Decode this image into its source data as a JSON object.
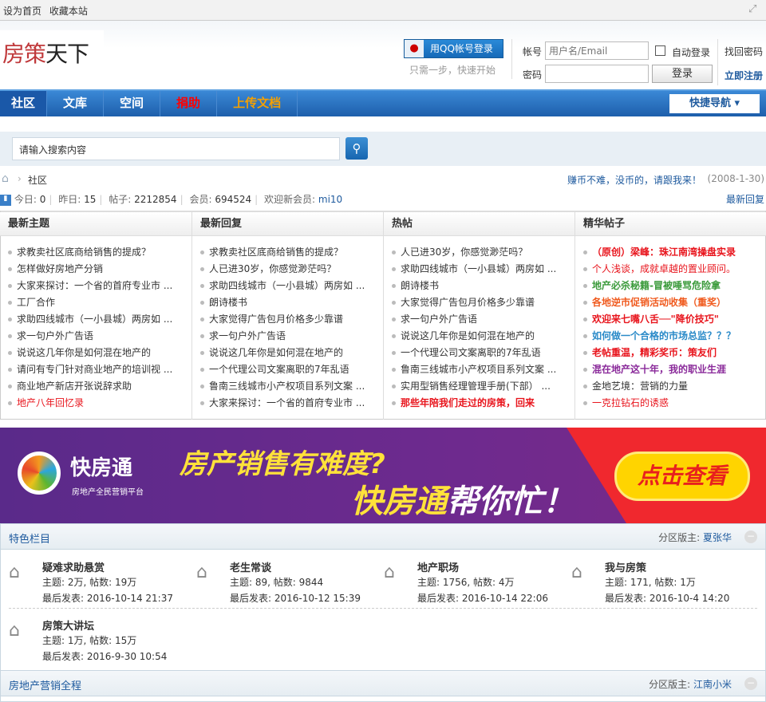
{
  "topbar": {
    "set_home": "设为首页",
    "bookmark": "收藏本站"
  },
  "logo": {
    "red": "房策",
    "black": "天下"
  },
  "login": {
    "qq_button": "用QQ帐号登录",
    "qq_tip": "只需一步，快速开始",
    "account_label": "帐号",
    "account_placeholder": "用户名/Email",
    "password_label": "密码",
    "auto_login": "自动登录",
    "login_button": "登录",
    "find_password": "找回密码",
    "register": "立即注册"
  },
  "nav": {
    "items": [
      {
        "label": "社区",
        "color": "#ffffff"
      },
      {
        "label": "文库",
        "color": "#ffffff"
      },
      {
        "label": "空间",
        "color": "#ffffff"
      },
      {
        "label": "捐助",
        "color": "#ff0000"
      },
      {
        "label": "上传文档",
        "color": "#f5a000"
      }
    ],
    "quick_nav": "快捷导航"
  },
  "search": {
    "placeholder": "请输入搜索内容"
  },
  "breadcrumb": {
    "current": "社区",
    "notice": "赚币不难，没币的，请跟我来！",
    "notice_date": "(2008-1-30)"
  },
  "stats": {
    "today_label": "今日:",
    "today": "0",
    "yesterday_label": "昨日:",
    "yesterday": "15",
    "posts_label": "帖子:",
    "posts": "2212854",
    "members_label": "会员:",
    "members": "694524",
    "newest_label": "欢迎新会员:",
    "newest": "mi10",
    "latest_replies": "最新回复"
  },
  "columns": [
    {
      "title": "最新主题",
      "items": [
        {
          "t": "求教卖社区底商给销售的提成？"
        },
        {
          "t": "怎样做好房地产分销"
        },
        {
          "t": "大家来探讨：一个省的首府专业市 ..."
        },
        {
          "t": "工厂合作"
        },
        {
          "t": "求助四线城市（一小县城）两房如 ..."
        },
        {
          "t": "求一句户外广告语"
        },
        {
          "t": "说说这几年你是如何混在地产的"
        },
        {
          "t": "请问有专门针对商业地产的培训视 ..."
        },
        {
          "t": "商业地产新店开张说辞求助"
        },
        {
          "t": "地产八年回忆录",
          "c": "#e8141c"
        }
      ]
    },
    {
      "title": "最新回复",
      "items": [
        {
          "t": "求教卖社区底商给销售的提成？"
        },
        {
          "t": "人已进30岁，你感觉渺茫吗？"
        },
        {
          "t": "求助四线城市（一小县城）两房如 ..."
        },
        {
          "t": "朗诗楼书"
        },
        {
          "t": "大家觉得广告包月价格多少靠谱"
        },
        {
          "t": "求一句户外广告语"
        },
        {
          "t": "说说这几年你是如何混在地产的"
        },
        {
          "t": "一个代理公司文案离职的7年乱语"
        },
        {
          "t": "鲁南三线城市小产权项目系列文案 ..."
        },
        {
          "t": "大家来探讨：一个省的首府专业市 ..."
        }
      ]
    },
    {
      "title": "热帖",
      "items": [
        {
          "t": "人已进30岁，你感觉渺茫吗？"
        },
        {
          "t": "求助四线城市（一小县城）两房如 ..."
        },
        {
          "t": "朗诗楼书"
        },
        {
          "t": "大家觉得广告包月价格多少靠谱"
        },
        {
          "t": "求一句户外广告语"
        },
        {
          "t": "说说这几年你是如何混在地产的"
        },
        {
          "t": "一个代理公司文案离职的7年乱语"
        },
        {
          "t": "鲁南三线城市小产权项目系列文案 ..."
        },
        {
          "t": "实用型销售经理管理手册(下部） ..."
        },
        {
          "t": "那些年陪我们走过的房策，回来",
          "c": "#e8141c",
          "b": true
        }
      ]
    },
    {
      "title": "精华帖子",
      "items": [
        {
          "t": "（原创）梁峰：珠江南湾操盘实录",
          "c": "#e8141c",
          "b": true
        },
        {
          "t": "个人浅谈，成就卓越的置业顾问。",
          "c": "#e8141c"
        },
        {
          "t": "地产必杀秘籍-冒被唾骂危险拿",
          "c": "#3a9a3a",
          "b": true
        },
        {
          "t": "各地逆市促销活动收集（重奖）",
          "c": "#f05a1e",
          "b": true
        },
        {
          "t": "欢迎来七嘴八舌──\"降价技巧\"",
          "c": "#e8141c",
          "b": true
        },
        {
          "t": "如何做一个合格的市场总监？？？",
          "c": "#2a8ac8",
          "b": true
        },
        {
          "t": "老帖重温，精彩奖币：策友们",
          "c": "#e8141c",
          "b": true
        },
        {
          "t": "混在地产这十年，我的职业生涯",
          "c": "#8a2a9a",
          "b": true
        },
        {
          "t": "金地艺境：营销的力量"
        },
        {
          "t": "一克拉钻石的诱惑",
          "c": "#e8141c"
        }
      ]
    }
  ],
  "banner": {
    "brand": "快房通",
    "brand_sub": "房地产全民营销平台",
    "line1": "房产销售有难度?",
    "line2a": "快房通",
    "line2b": "帮你忙！",
    "cta": "点击查看"
  },
  "sections": [
    {
      "title": "特色栏目",
      "moderator_label": "分区版主:",
      "moderator": "夏张华",
      "forums": [
        {
          "name": "疑难求助悬赏",
          "stats": "主题: 2万, 帖数: 19万",
          "last": "最后发表: 2016-10-14 21:37"
        },
        {
          "name": "老生常谈",
          "stats": "主题: 89, 帖数: 9844",
          "last": "最后发表: 2016-10-12 15:39"
        },
        {
          "name": "地产职场",
          "stats": "主题: 1756, 帖数: 4万",
          "last": "最后发表: 2016-10-14 22:06"
        },
        {
          "name": "我与房策",
          "stats": "主题: 171, 帖数: 1万",
          "last": "最后发表: 2016-10-4 14:20"
        },
        {
          "name": "房策大讲坛",
          "stats": "主题: 1万, 帖数: 15万",
          "last": "最后发表: 2016-9-30 10:54"
        }
      ]
    },
    {
      "title": "房地产营销全程",
      "moderator_label": "分区版主:",
      "moderator": "江南小米"
    }
  ]
}
